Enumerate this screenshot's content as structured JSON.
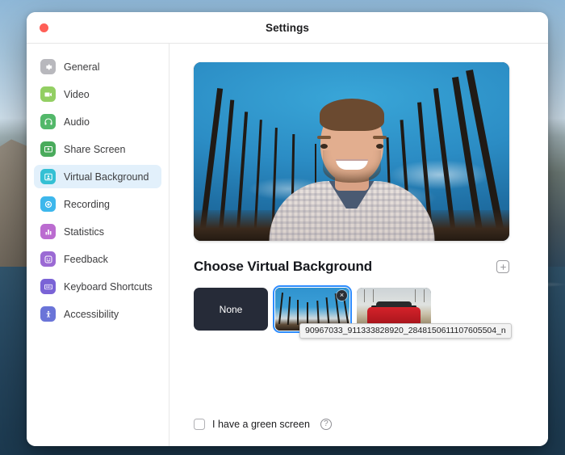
{
  "window": {
    "title": "Settings",
    "close_button": "close"
  },
  "sidebar": {
    "items": [
      {
        "label": "General",
        "icon": "gear-icon",
        "color": "#b8b8bd",
        "selected": false
      },
      {
        "label": "Video",
        "icon": "video-camera-icon",
        "color": "#93cf63",
        "selected": false
      },
      {
        "label": "Audio",
        "icon": "headphones-icon",
        "color": "#53b86a",
        "selected": false
      },
      {
        "label": "Share Screen",
        "icon": "share-screen-icon",
        "color": "#4aab5c",
        "selected": false
      },
      {
        "label": "Virtual Background",
        "icon": "person-frame-icon",
        "color": "#34c0d4",
        "selected": true
      },
      {
        "label": "Recording",
        "icon": "record-circle-icon",
        "color": "#3db7ec",
        "selected": false
      },
      {
        "label": "Statistics",
        "icon": "bar-chart-icon",
        "color": "#bb6cd0",
        "selected": false
      },
      {
        "label": "Feedback",
        "icon": "smiley-face-icon",
        "color": "#9b6ad4",
        "selected": false
      },
      {
        "label": "Keyboard Shortcuts",
        "icon": "keyboard-icon",
        "color": "#7a63d6",
        "selected": false
      },
      {
        "label": "Accessibility",
        "icon": "accessibility-icon",
        "color": "#6a74d8",
        "selected": false
      }
    ],
    "highlight_color": "#e2f0fb"
  },
  "main": {
    "preview": {
      "description": "Self-view camera preview: smiling man in plaid shirt with bare-trees-and-blue-sky virtual background"
    },
    "section_title": "Choose Virtual Background",
    "add_button": "+",
    "backgrounds": [
      {
        "name": "None",
        "type": "none",
        "selected": false,
        "removable": false
      },
      {
        "name": "forest-trees",
        "type": "image",
        "selected": true,
        "removable": true
      },
      {
        "name": "red-car",
        "type": "image",
        "selected": false,
        "removable": false
      }
    ],
    "tooltip": "90967033_911333828920_2848150611107605504_n",
    "selection_color": "#2d8cff",
    "green_screen": {
      "label": "I have a green screen",
      "checked": false,
      "help": "?"
    }
  }
}
